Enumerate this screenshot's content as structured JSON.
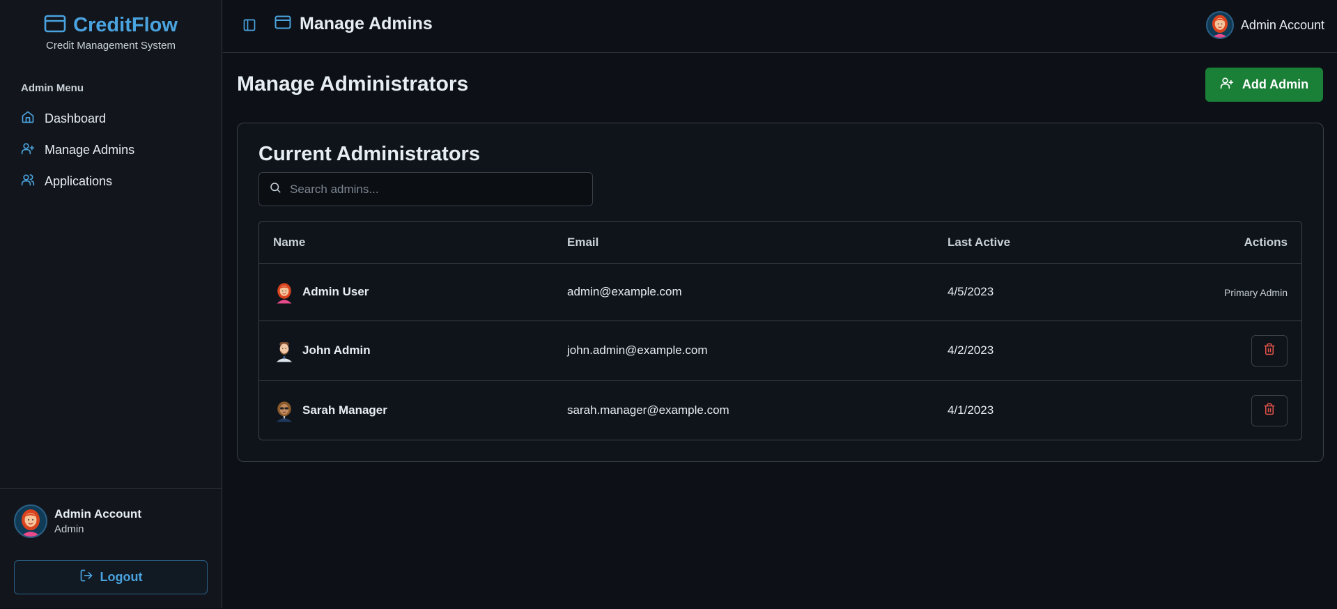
{
  "brand": {
    "name": "CreditFlow",
    "subtitle": "Credit Management System"
  },
  "sidebar": {
    "menu_title": "Admin Menu",
    "items": [
      {
        "label": "Dashboard",
        "icon": "home-icon"
      },
      {
        "label": "Manage Admins",
        "icon": "user-plus-icon"
      },
      {
        "label": "Applications",
        "icon": "users-icon"
      }
    ],
    "user": {
      "name": "Admin Account",
      "role": "Admin"
    },
    "logout_label": "Logout"
  },
  "topbar": {
    "title": "Manage Admins",
    "account_label": "Admin Account"
  },
  "page": {
    "title": "Manage Administrators",
    "add_button_label": "Add Admin"
  },
  "card": {
    "title": "Current Administrators"
  },
  "search": {
    "placeholder": "Search admins...",
    "value": ""
  },
  "table": {
    "columns": [
      "Name",
      "Email",
      "Last Active",
      "Actions"
    ],
    "rows": [
      {
        "name": "Admin User",
        "email": "admin@example.com",
        "last_active": "4/5/2023",
        "action": "Primary Admin",
        "avatar": "female-avatar"
      },
      {
        "name": "John Admin",
        "email": "john.admin@example.com",
        "last_active": "4/2/2023",
        "action": "delete",
        "avatar": "male-avatar"
      },
      {
        "name": "Sarah Manager",
        "email": "sarah.manager@example.com",
        "last_active": "4/1/2023",
        "action": "delete",
        "avatar": "female-sunglasses-avatar"
      }
    ]
  },
  "colors": {
    "accent": "#4aa3df",
    "success": "#1a7f37",
    "danger": "#e5534b",
    "background": "#0d1117"
  }
}
